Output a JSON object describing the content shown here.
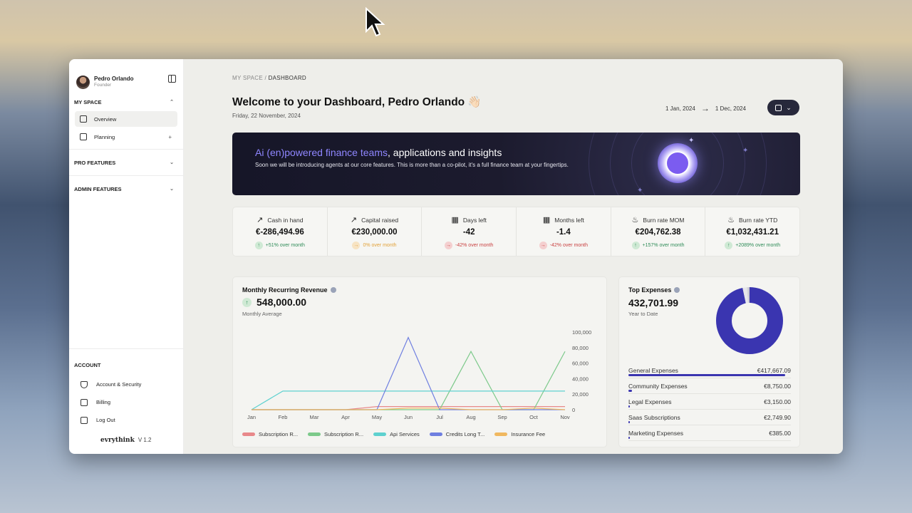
{
  "sidebar": {
    "user": {
      "name": "Pedro Orlando",
      "role": "Founder"
    },
    "my_space": {
      "label": "MY SPACE",
      "items": [
        {
          "label": "Overview"
        },
        {
          "label": "Planning"
        }
      ]
    },
    "pro_features": "PRO FEATURES",
    "admin_features": "ADMIN FEATURES",
    "account": {
      "label": "ACCOUNT",
      "items": [
        {
          "label": "Account & Security"
        },
        {
          "label": "Billing"
        },
        {
          "label": "Log Out"
        }
      ]
    },
    "brand": "evrythink",
    "version": "V 1.2"
  },
  "header": {
    "breadcrumb_root": "MY SPACE",
    "breadcrumb_sep": " / ",
    "breadcrumb_current": "DASHBOARD",
    "welcome": "Welcome to your Dashboard, Pedro Orlando 👋🏻",
    "date": "Friday, 22 November, 2024",
    "range_start": "1 Jan, 2024",
    "range_end": "1 Dec, 2024"
  },
  "banner": {
    "title_highlight": "Ai (en)powered finance teams",
    "title_rest": ", applications and insights",
    "text": "Soon we will be introducing agents at our core features. This is more than a co-pilot, it's a full finance team at your fingertips."
  },
  "stats": [
    {
      "label": "Cash in hand",
      "icon": "trend-up-icon",
      "value": "€-286,494.96",
      "change": "+51% over month",
      "dir": "up"
    },
    {
      "label": "Capital raised",
      "icon": "trend-up-icon",
      "value": "€230,000.00",
      "change": "0% over month",
      "dir": "neu"
    },
    {
      "label": "Days left",
      "icon": "calendar-icon",
      "value": "-42",
      "change": "-42% over month",
      "dir": "down"
    },
    {
      "label": "Months left",
      "icon": "calendar-icon",
      "value": "-1.4",
      "change": "-42% over month",
      "dir": "down"
    },
    {
      "label": "Burn rate MOM",
      "icon": "flame-icon",
      "value": "€204,762.38",
      "change": "+157% over month",
      "dir": "up"
    },
    {
      "label": "Burn rate YTD",
      "icon": "flame-icon",
      "value": "€1,032,431.21",
      "change": "+2089% over month",
      "dir": "up"
    }
  ],
  "mrr": {
    "title": "Monthly Recurring Revenue",
    "value": "548,000.00",
    "subtitle": "Monthly Average"
  },
  "chart_data": {
    "type": "line",
    "categories": [
      "Jan",
      "Feb",
      "Mar",
      "Apr",
      "May",
      "Jun",
      "Jul",
      "Aug",
      "Sep",
      "Oct",
      "Nov"
    ],
    "ylim": [
      0,
      100000
    ],
    "yticks": [
      "100,000",
      "80,000",
      "60,000",
      "40,000",
      "20,000",
      "0"
    ],
    "series": [
      {
        "name": "Subscription R...",
        "color": "#e8888a",
        "values": [
          0,
          0,
          0,
          0,
          4000,
          4000,
          4000,
          4000,
          4000,
          4000,
          4000
        ]
      },
      {
        "name": "Subscription R...",
        "color": "#7cc98a",
        "values": [
          0,
          0,
          0,
          0,
          0,
          0,
          0,
          75000,
          0,
          0,
          75000
        ]
      },
      {
        "name": "Api Services",
        "color": "#5ed1cf",
        "values": [
          0,
          24000,
          24000,
          24000,
          24000,
          24000,
          24000,
          24000,
          24000,
          24000,
          24000
        ]
      },
      {
        "name": "Credits Long T...",
        "color": "#6f7fe0",
        "values": [
          0,
          0,
          0,
          0,
          0,
          93000,
          0,
          0,
          0,
          0,
          0
        ]
      },
      {
        "name": "Insurance Fee",
        "color": "#f0b860",
        "values": [
          0,
          0,
          0,
          0,
          0,
          2000,
          2000,
          0,
          0,
          2000,
          0
        ]
      }
    ]
  },
  "expenses": {
    "title": "Top Expenses",
    "value": "432,701.99",
    "subtitle": "Year to Date",
    "donut_color": "#3a35b0",
    "items": [
      {
        "label": "General Expenses",
        "value": "€417,667.09",
        "share": 0.965
      },
      {
        "label": "Community Expenses",
        "value": "€8,750.00",
        "share": 0.02
      },
      {
        "label": "Legal Expenses",
        "value": "€3,150.00",
        "share": 0.007
      },
      {
        "label": "Saas Subscriptions",
        "value": "€2,749.90",
        "share": 0.006
      },
      {
        "label": "Marketing Expenses",
        "value": "€385.00",
        "share": 0.001
      }
    ]
  }
}
